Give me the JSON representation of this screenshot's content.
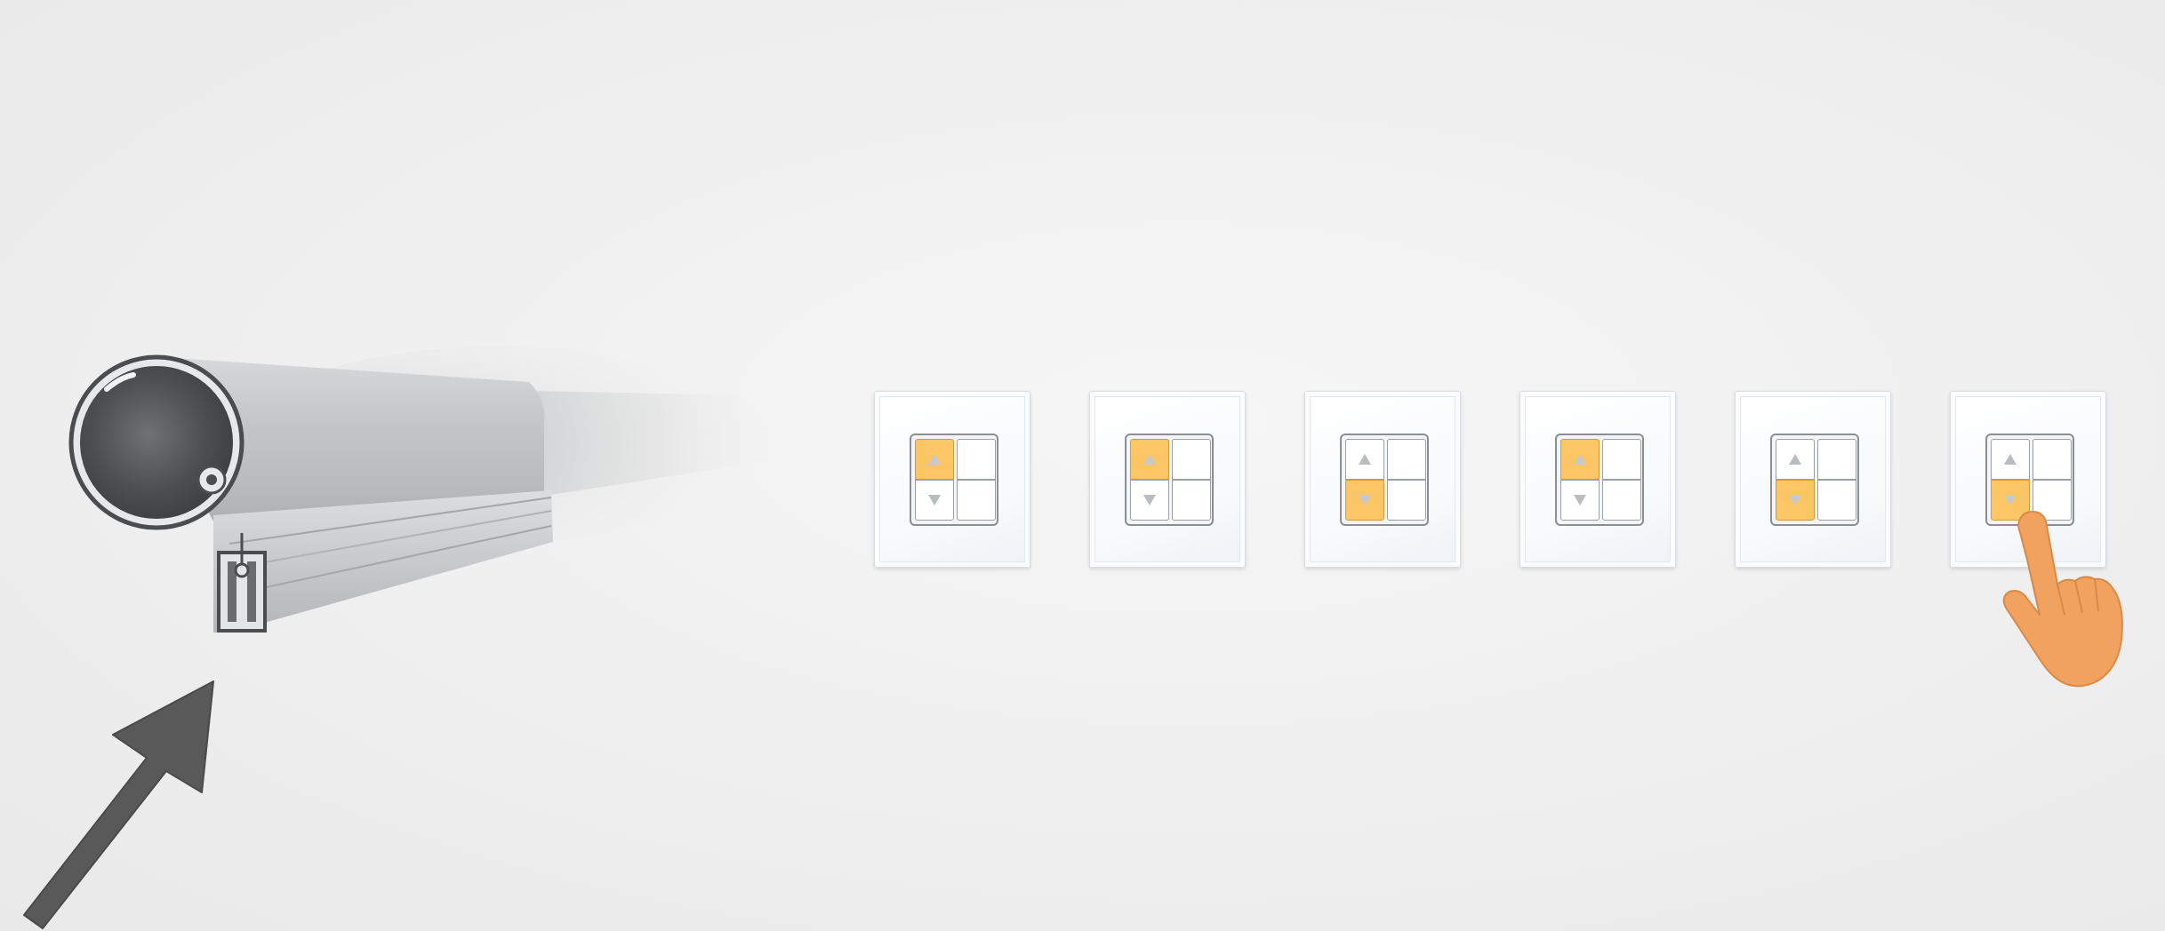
{
  "scene": {
    "background_color": "#efefef",
    "accent_color": "#fcc565",
    "hand_color": "#f0a25e",
    "arrow_color": "#595959",
    "profile_color": "#c9cbcd"
  },
  "illustration": {
    "roller_profile": "aluminium-roller-tube-profile",
    "pointer": "arrow-icon",
    "hand": "pointing-hand-icon"
  },
  "switches": [
    {
      "id": "switch-1",
      "active": "up"
    },
    {
      "id": "switch-2",
      "active": "up"
    },
    {
      "id": "switch-3",
      "active": "down"
    },
    {
      "id": "switch-4",
      "active": "up"
    },
    {
      "id": "switch-5",
      "active": "down"
    },
    {
      "id": "switch-6",
      "active": "down",
      "pressed": true
    }
  ]
}
